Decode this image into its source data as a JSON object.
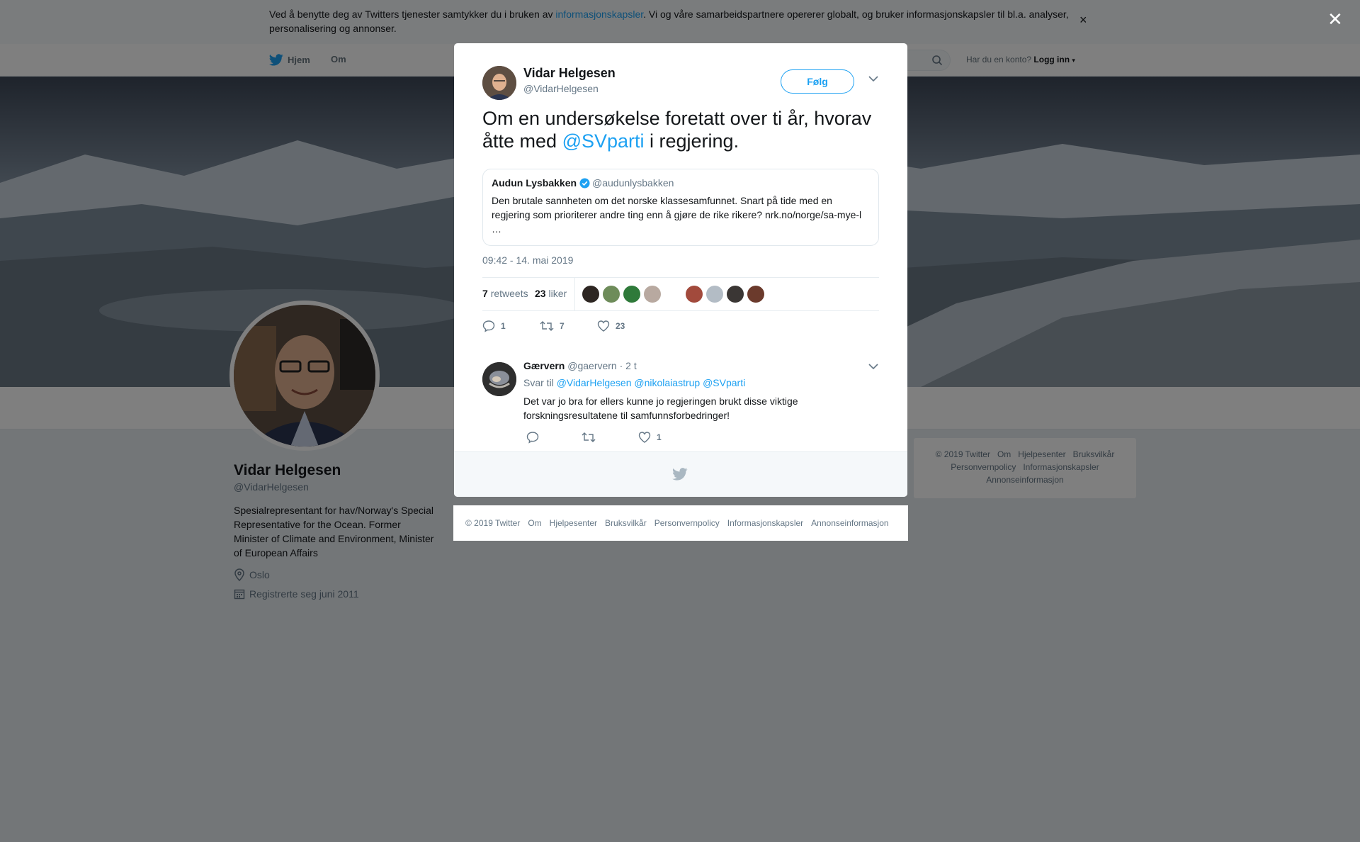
{
  "cookie_bar": {
    "text_before": "Ved å benytte deg av Twitters tjenester samtykker du i bruken av ",
    "link": "informasjonskapsler",
    "text_after": ". Vi og våre samarbeidspartnere opererer globalt, og bruker informasjonskapsler til bl.a. analyser, personalisering og annonser.",
    "close": "×"
  },
  "nav": {
    "home": "Hjem",
    "about": "Om",
    "account_prompt": "Har du en konto?",
    "login": "Logg inn"
  },
  "profile": {
    "name": "Vidar Helgesen",
    "handle": "@VidarHelgesen",
    "bio": "Spesialrepresentant for hav/Norway's Special Representative for the Ocean. Former Minister of Climate and Environment, Minister of European Affairs",
    "location": "Oslo",
    "joined": "Registrerte seg juni 2011"
  },
  "right_footer": {
    "links": [
      "© 2019 Twitter",
      "Om",
      "Hjelpesenter",
      "Bruksvilkår",
      "Personvernpolicy",
      "Informasjonskapsler",
      "Annonseinformasjon"
    ]
  },
  "overlay": {
    "close": "✕"
  },
  "tweet": {
    "author_name": "Vidar Helgesen",
    "author_handle": "@VidarHelgesen",
    "follow_label": "Følg",
    "text_before": "Om en undersøkelse foretatt over ti år, hvorav åtte med ",
    "mention": "@SVparti",
    "text_after": " i regjering.",
    "quote": {
      "name": "Audun Lysbakken",
      "handle": "@audunlysbakken",
      "text": "Den brutale sannheten om det norske klassesamfunnet. Snart på tide med en regjering som prioriterer andre ting enn å gjøre de rike rikere? nrk.no/norge/sa-mye-l …"
    },
    "timestamp": "09:42 - 14. mai 2019",
    "retweets_count": "7",
    "retweets_label": "retweets",
    "likes_count": "23",
    "likes_label": "liker",
    "actions": {
      "replies": "1",
      "retweets": "7",
      "likes": "23"
    }
  },
  "reply": {
    "name": "Gærvern",
    "handle": "@gaervern",
    "time": "· 2 t",
    "reply_to_label": "Svar til",
    "reply_to": [
      "@VidarHelgesen",
      "@nikolaiastrup",
      "@SVparti"
    ],
    "text": "Det var jo bra for ellers kunne jo regjeringen brukt disse viktige forskningsresultatene til samfunnsforbedringer!",
    "actions": {
      "replies": "",
      "retweets": "",
      "likes": "1"
    }
  },
  "bottom_footer": {
    "links": [
      "© 2019 Twitter",
      "Om",
      "Hjelpesenter",
      "Bruksvilkår",
      "Personvernpolicy",
      "Informasjonskapsler",
      "Annonseinformasjon"
    ]
  },
  "colors": {
    "accent": "#1da1f2",
    "text": "#14171a",
    "muted": "#657786"
  }
}
